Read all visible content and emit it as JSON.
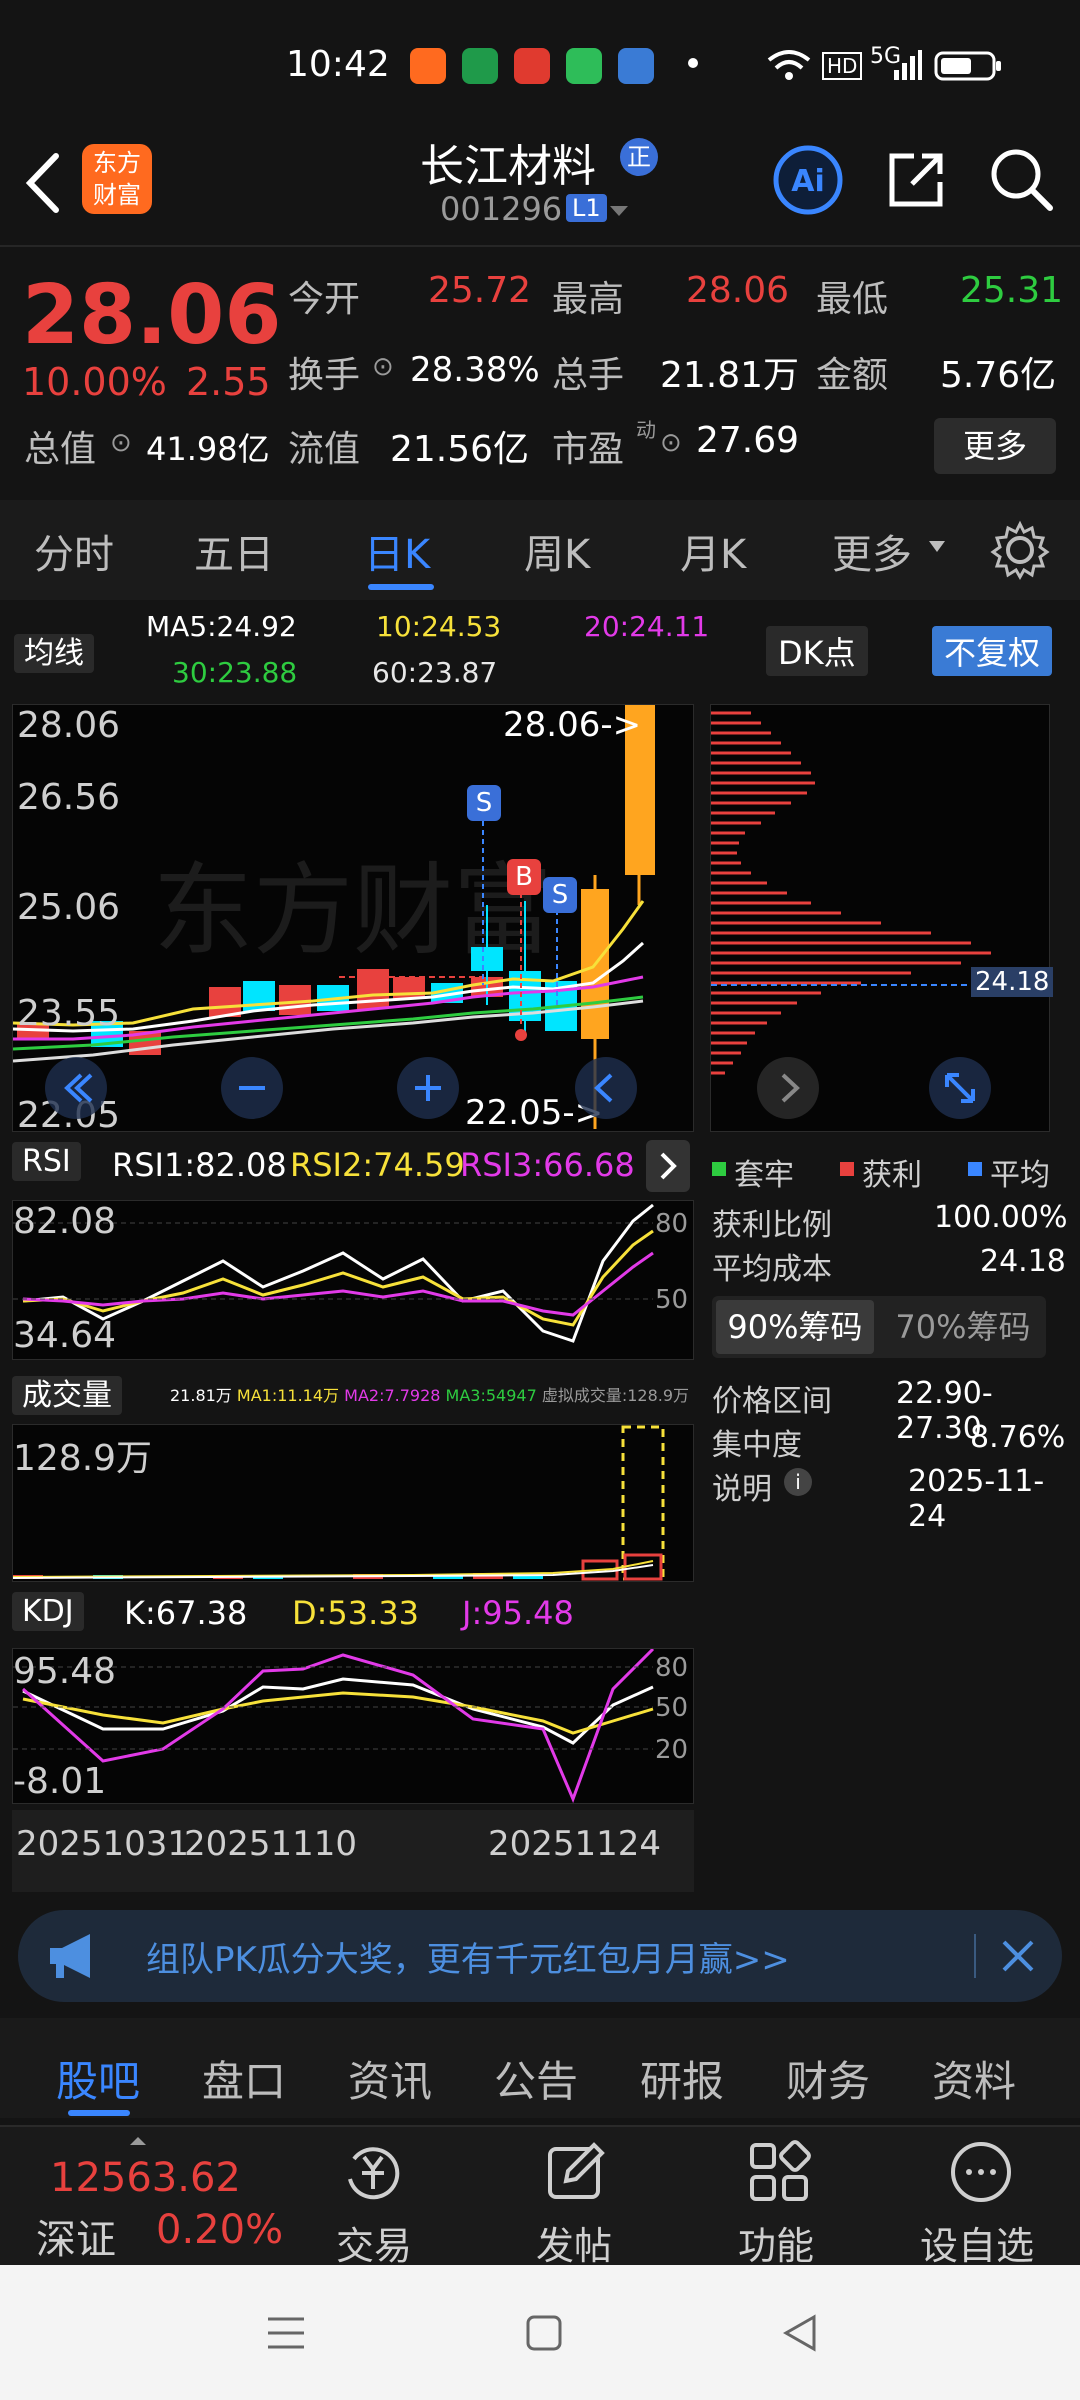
{
  "status": {
    "time": "10:42",
    "network": "5G"
  },
  "header": {
    "title": "长江材料",
    "badge": "正",
    "code": "001296",
    "level": "L1",
    "logo_text": "东方财富"
  },
  "quote": {
    "price": "28.06",
    "change_pct": "10.00%",
    "change": "2.55",
    "total_value_label": "总值",
    "total_value": "41.98亿",
    "fields": [
      {
        "label": "今开",
        "value": "25.72"
      },
      {
        "label": "最高",
        "value": "28.06"
      },
      {
        "label": "最低",
        "value": "25.31"
      },
      {
        "label": "换手",
        "value": "28.38%"
      },
      {
        "label": "总手",
        "value": "21.81万"
      },
      {
        "label": "金额",
        "value": "5.76亿"
      },
      {
        "label": "流值",
        "value": "21.56亿"
      },
      {
        "label": "市盈",
        "value": "27.69"
      }
    ],
    "pe_superscript": "动",
    "more_button": "更多"
  },
  "tabs": [
    "分时",
    "五日",
    "日K",
    "周K",
    "月K",
    "更多"
  ],
  "active_tab": "日K",
  "ma": {
    "dropdown": "均线",
    "ma5": "MA5:24.92",
    "ma10": "10:24.53",
    "ma20": "20:24.11",
    "ma30": "30:23.88",
    "ma60": "60:23.87",
    "dk_button": "DK点",
    "adjust_button": "不复权"
  },
  "kline": {
    "y_labels": [
      "28.06",
      "26.56",
      "25.06",
      "23.55",
      "22.05"
    ],
    "high_marker": "28.06->",
    "low_marker": "22.05->",
    "markers": [
      "S",
      "B",
      "S"
    ],
    "watermark": "东方财富"
  },
  "rsi": {
    "dropdown": "RSI",
    "rsi1": "RSI1:82.08",
    "rsi2": "RSI2:74.59",
    "rsi3": "RSI3:66.68",
    "y_top": "82.08",
    "y_bottom": "34.64",
    "guide_80": "80",
    "guide_50": "50"
  },
  "volume": {
    "dropdown": "成交量",
    "legend": [
      "21.81万",
      "MA1:11.14万",
      "MA2:7.7928",
      "MA3:54947",
      "虚拟成交量:128.9万"
    ],
    "y_top": "128.9万"
  },
  "kdj": {
    "dropdown": "KDJ",
    "k": "K:67.38",
    "d": "D:53.33",
    "j": "J:95.48",
    "y_top": "95.48",
    "y_bottom": "-8.01",
    "guides": [
      "80",
      "50",
      "20"
    ]
  },
  "dates": [
    "20251031",
    "20251110",
    "20251124"
  ],
  "chips": {
    "price_marker": "24.18",
    "legend": [
      {
        "label": "套牢",
        "color": "#2ecc40"
      },
      {
        "label": "获利",
        "color": "#e8413e"
      },
      {
        "label": "平均",
        "color": "#3a86ff"
      }
    ],
    "profit_ratio_label": "获利比例",
    "profit_ratio": "100.00%",
    "avg_cost_label": "平均成本",
    "avg_cost": "24.18",
    "tab_90": "90%筹码",
    "tab_70": "70%筹码",
    "range_label": "价格区间",
    "range": "22.90-27.30",
    "concentration_label": "集中度",
    "concentration": "8.76%",
    "note_label": "说明",
    "note_date": "2025-11-24"
  },
  "banner": {
    "text": "组队PK瓜分大奖，更有千元红包月月赢>>"
  },
  "bottom_tabs": [
    "股吧",
    "盘口",
    "资讯",
    "公告",
    "研报",
    "财务",
    "资料"
  ],
  "footer": {
    "index_value": "12563.62",
    "index_name": "深证",
    "index_change": "0.20%",
    "actions": [
      "交易",
      "发帖",
      "功能",
      "设自选"
    ]
  },
  "colors": {
    "up": "#e8413e",
    "down": "#00e5ff",
    "accent": "#3a86ff",
    "bg": "#141414"
  }
}
